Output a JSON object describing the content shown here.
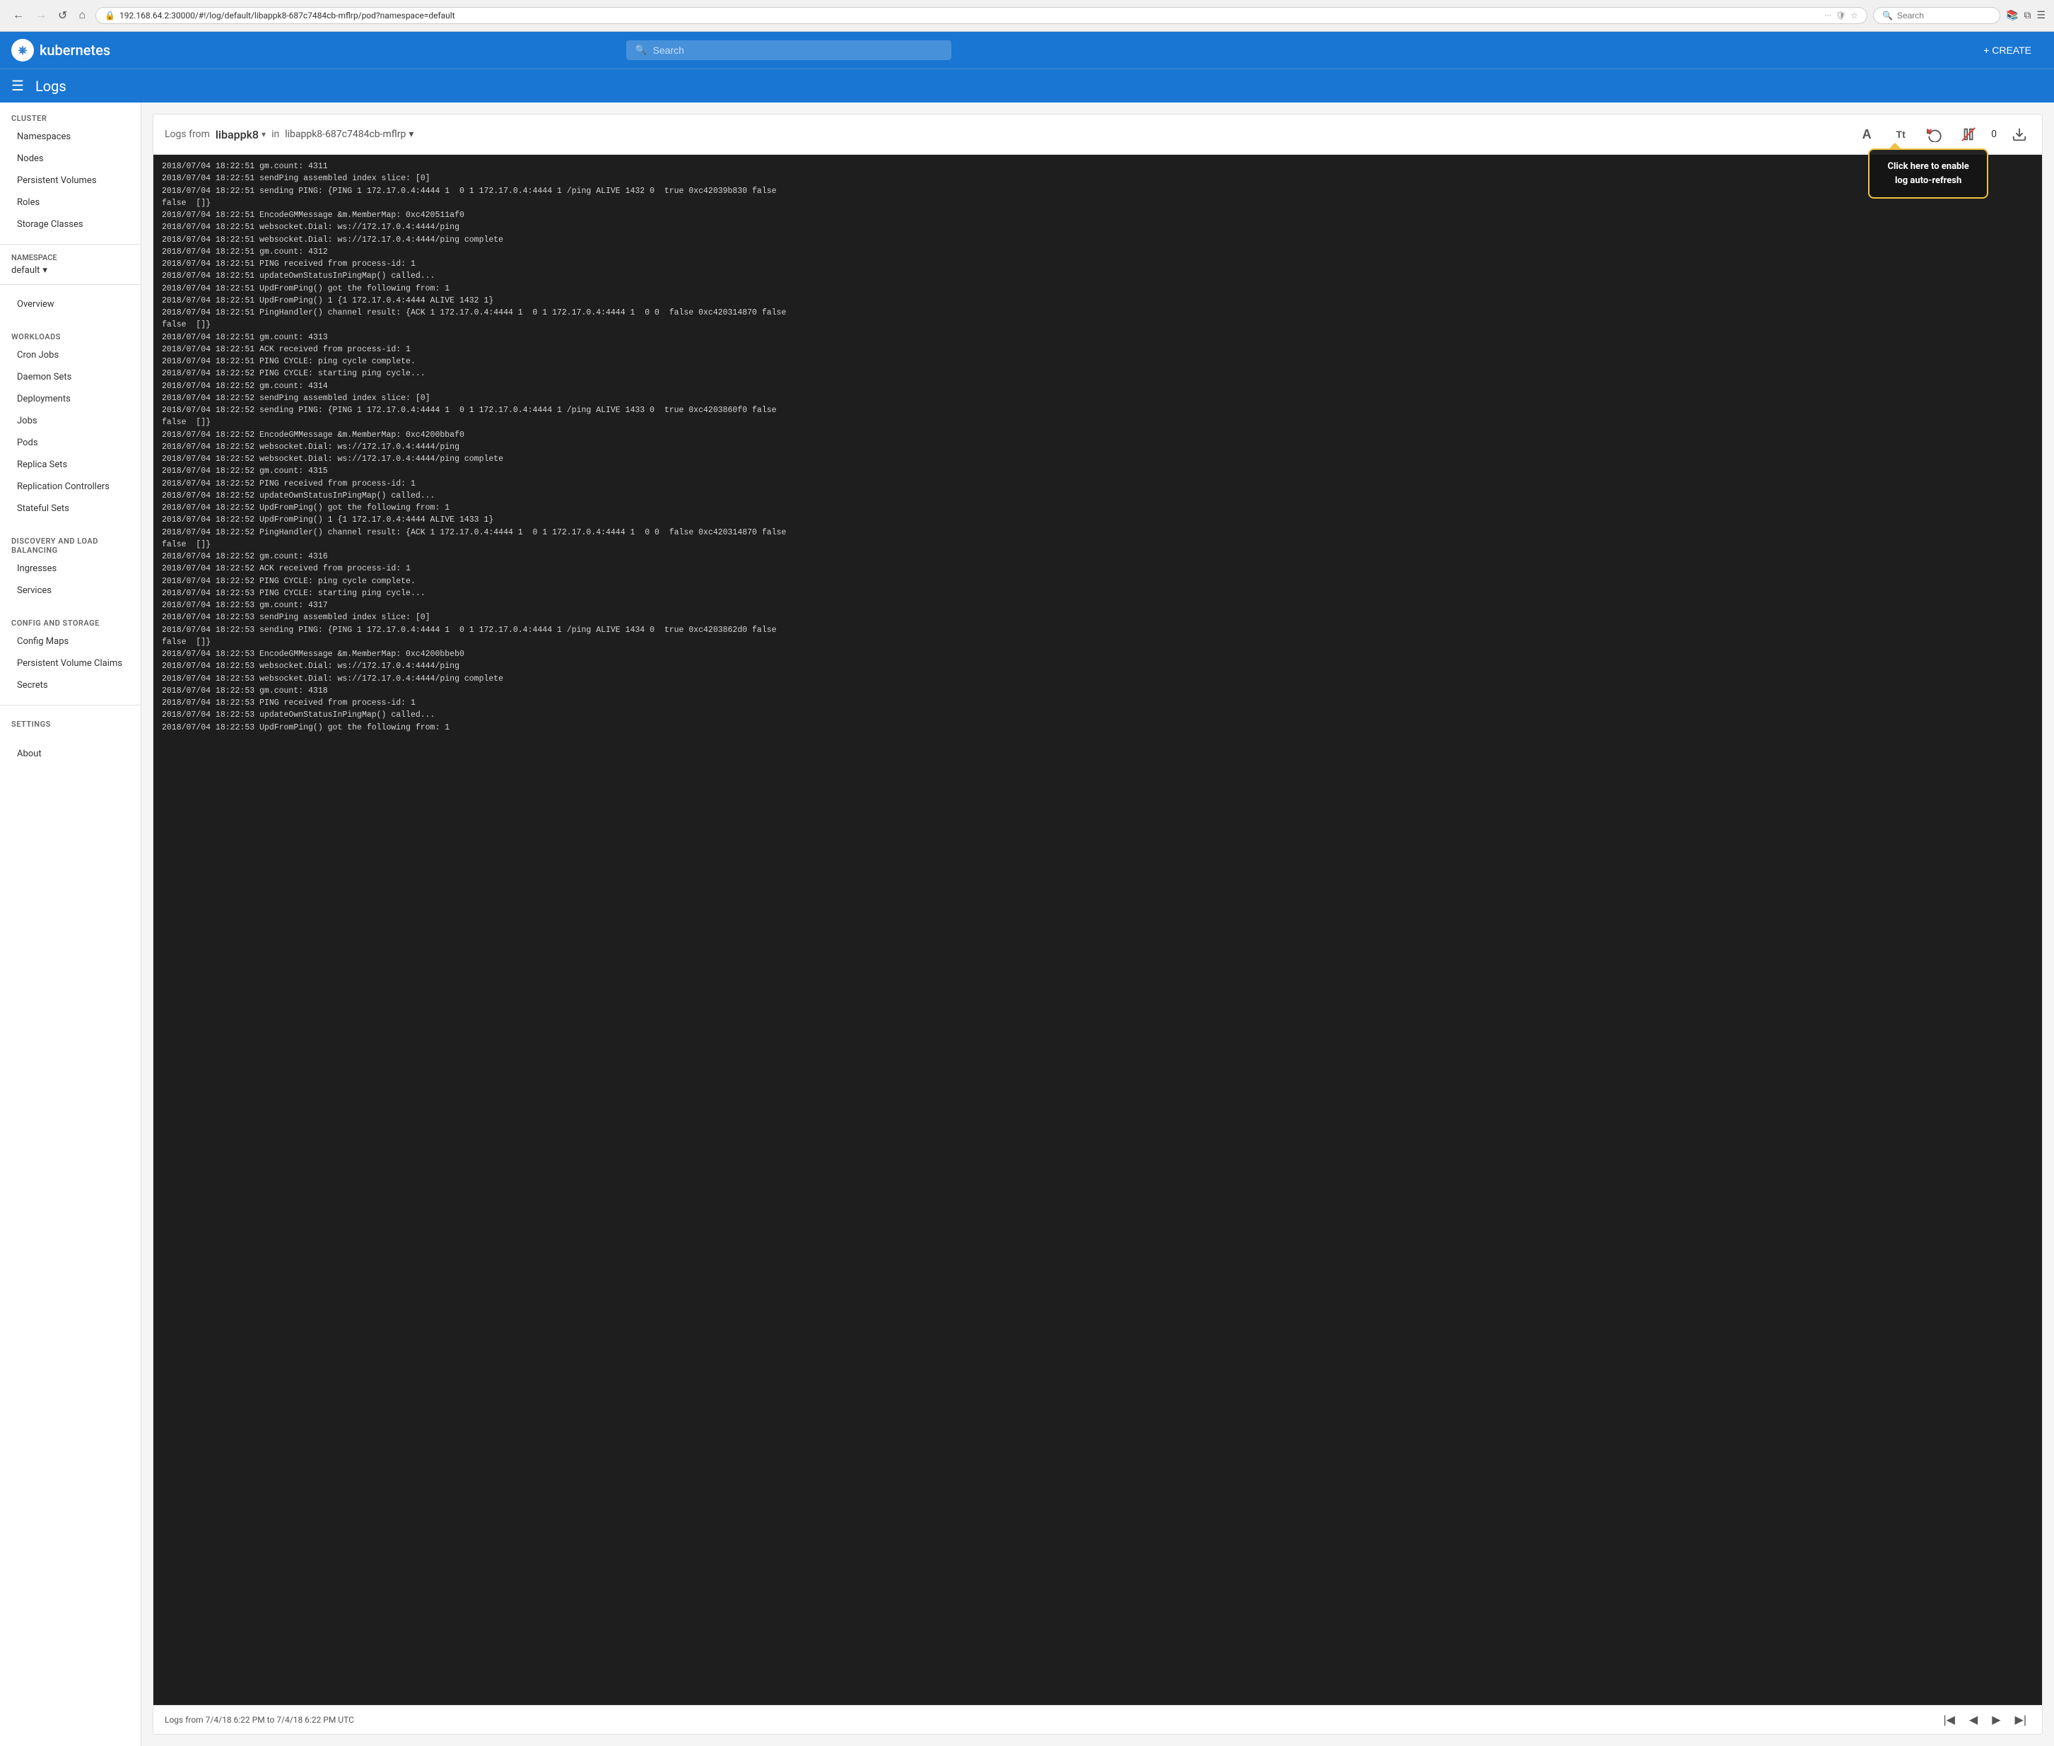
{
  "browser": {
    "url": "192.168.64.2:30000/#!/log/default/libappk8-687c7484cb-mflrp/pod?namespace=default",
    "search_placeholder": "Search",
    "back_disabled": false,
    "forward_disabled": true
  },
  "app": {
    "logo_letter": "K",
    "app_name": "kubernetes",
    "search_placeholder": "Search",
    "create_label": "+ CREATE"
  },
  "page": {
    "title": "Logs",
    "menu_icon": "☰"
  },
  "sidebar": {
    "cluster_section": "Cluster",
    "cluster_items": [
      {
        "label": "Namespaces",
        "id": "namespaces"
      },
      {
        "label": "Nodes",
        "id": "nodes"
      },
      {
        "label": "Persistent Volumes",
        "id": "persistent-volumes"
      },
      {
        "label": "Roles",
        "id": "roles"
      },
      {
        "label": "Storage Classes",
        "id": "storage-classes"
      }
    ],
    "namespace_label": "Namespace",
    "namespace_value": "default",
    "overview_label": "Overview",
    "workloads_section": "Workloads",
    "workloads_items": [
      {
        "label": "Cron Jobs",
        "id": "cron-jobs"
      },
      {
        "label": "Daemon Sets",
        "id": "daemon-sets"
      },
      {
        "label": "Deployments",
        "id": "deployments"
      },
      {
        "label": "Jobs",
        "id": "jobs"
      },
      {
        "label": "Pods",
        "id": "pods"
      },
      {
        "label": "Replica Sets",
        "id": "replica-sets"
      },
      {
        "label": "Replication Controllers",
        "id": "replication-controllers"
      },
      {
        "label": "Stateful Sets",
        "id": "stateful-sets"
      }
    ],
    "discovery_section": "Discovery and Load Balancing",
    "discovery_items": [
      {
        "label": "Ingresses",
        "id": "ingresses"
      },
      {
        "label": "Services",
        "id": "services"
      }
    ],
    "config_section": "Config and Storage",
    "config_items": [
      {
        "label": "Config Maps",
        "id": "config-maps"
      },
      {
        "label": "Persistent Volume Claims",
        "id": "persistent-volume-claims"
      },
      {
        "label": "Secrets",
        "id": "secrets"
      }
    ],
    "settings_section": "Settings",
    "about_label": "About"
  },
  "logs": {
    "from_label": "Logs from",
    "pod_name": "libappk8",
    "in_label": "in",
    "container_name": "libappk8-687c7484cb-mflrp",
    "count": "0",
    "tooltip_text": "Click here to enable log auto-refresh",
    "status_bar": "Logs from 7/4/18 6:22 PM to 7/4/18 6:22 PM UTC",
    "lines": [
      "2018/07/04 18:22:51 gm.count: 4311",
      "2018/07/04 18:22:51 sendPing assembled index slice: [0]",
      "2018/07/04 18:22:51 sending PING: {PING 1 172.17.0.4:4444 1  0 1 172.17.0.4:4444 1 /ping ALIVE 1432 0  true 0xc42039b830 false",
      "false  []}",
      "2018/07/04 18:22:51 EncodeGMMessage &amp;m.MemberMap: 0xc420511af0",
      "2018/07/04 18:22:51 websocket.Dial: ws://172.17.0.4:4444/ping",
      "2018/07/04 18:22:51 websocket.Dial: ws://172.17.0.4:4444/ping complete",
      "2018/07/04 18:22:51 gm.count: 4312",
      "2018/07/04 18:22:51 PING received from process-id: 1",
      "2018/07/04 18:22:51 updateOwnStatusInPingMap() called...",
      "2018/07/04 18:22:51 UpdFromPing() got the following from: 1",
      "2018/07/04 18:22:51 UpdFromPing() 1 {1 172.17.0.4:4444 ALIVE 1432 1}",
      "2018/07/04 18:22:51 PingHandler() channel result: {ACK 1 172.17.0.4:4444 1  0 1 172.17.0.4:4444 1  0 0  false 0xc420314870 false",
      "false  []}",
      "2018/07/04 18:22:51 gm.count: 4313",
      "2018/07/04 18:22:51 ACK received from process-id: 1",
      "2018/07/04 18:22:51 PING CYCLE: ping cycle complete.",
      "2018/07/04 18:22:52 PING CYCLE: starting ping cycle...",
      "2018/07/04 18:22:52 gm.count: 4314",
      "2018/07/04 18:22:52 sendPing assembled index slice: [0]",
      "2018/07/04 18:22:52 sending PING: {PING 1 172.17.0.4:4444 1  0 1 172.17.0.4:4444 1 /ping ALIVE 1433 0  true 0xc4203860f0 false",
      "false  []}",
      "2018/07/04 18:22:52 EncodeGMMessage &amp;m.MemberMap: 0xc4200bbaf0",
      "2018/07/04 18:22:52 websocket.Dial: ws://172.17.0.4:4444/ping",
      "2018/07/04 18:22:52 websocket.Dial: ws://172.17.0.4:4444/ping complete",
      "2018/07/04 18:22:52 gm.count: 4315",
      "2018/07/04 18:22:52 PING received from process-id: 1",
      "2018/07/04 18:22:52 updateOwnStatusInPingMap() called...",
      "2018/07/04 18:22:52 UpdFromPing() got the following from: 1",
      "2018/07/04 18:22:52 UpdFromPing() 1 {1 172.17.0.4:4444 ALIVE 1433 1}",
      "2018/07/04 18:22:52 PingHandler() channel result: {ACK 1 172.17.0.4:4444 1  0 1 172.17.0.4:4444 1  0 0  false 0xc420314870 false",
      "false  []}",
      "2018/07/04 18:22:52 gm.count: 4316",
      "2018/07/04 18:22:52 ACK received from process-id: 1",
      "2018/07/04 18:22:52 PING CYCLE: ping cycle complete.",
      "2018/07/04 18:22:53 PING CYCLE: starting ping cycle...",
      "2018/07/04 18:22:53 gm.count: 4317",
      "2018/07/04 18:22:53 sendPing assembled index slice: [0]",
      "2018/07/04 18:22:53 sending PING: {PING 1 172.17.0.4:4444 1  0 1 172.17.0.4:4444 1 /ping ALIVE 1434 0  true 0xc4203862d0 false",
      "false  []}",
      "2018/07/04 18:22:53 EncodeGMMessage &amp;m.MemberMap: 0xc4200bbeb0",
      "2018/07/04 18:22:53 websocket.Dial: ws://172.17.0.4:4444/ping",
      "2018/07/04 18:22:53 websocket.Dial: ws://172.17.0.4:4444/ping complete",
      "2018/07/04 18:22:53 gm.count: 4318",
      "2018/07/04 18:22:53 PING received from process-id: 1",
      "2018/07/04 18:22:53 updateOwnStatusInPingMap() called...",
      "2018/07/04 18:22:53 UpdFromPing() got the following from: 1"
    ]
  },
  "icons": {
    "text_size": "A",
    "font_size": "Tt",
    "pause": "⏸",
    "refresh": "↺",
    "download": "⬇"
  }
}
